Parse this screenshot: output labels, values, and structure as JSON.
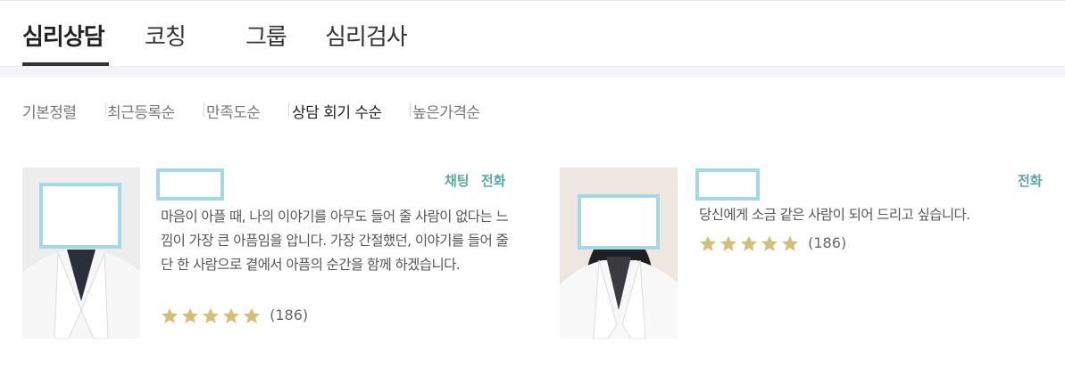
{
  "tabs": [
    "심리상담",
    "코칭",
    "그룹",
    "심리검사"
  ],
  "sort_options": [
    "기본정렬",
    "최근등록순",
    "만족도순",
    "상담 회기 수순",
    "높은가격순"
  ],
  "active_sort": "상담 회기 수순",
  "counselors": [
    {
      "tags": [
        "채팅",
        "전화"
      ],
      "description": "마음이 아플 때, 나의 이야기를 아무도 들어 줄 사람이 없다는 느낌이 가장 큰 아픔임을 압니다. 가장 간절했던, 이야기를 들어 줄 단 한 사람으로 곁에서 아픔의 순간을 함께 하겠습니다.",
      "stars": 5,
      "review_count": "(186)"
    },
    {
      "tags": [
        "전화"
      ],
      "description": "당신에게 소금 같은 사람이 되어 드리고 싶습니다.",
      "stars": 5,
      "review_count": "(186)"
    }
  ],
  "colors": {
    "accent": "#5aa7a5",
    "star": "#d4bf7a",
    "mask": "#a5d8e6",
    "band": "#f4f3f8"
  },
  "icons": [
    "star-icon"
  ]
}
